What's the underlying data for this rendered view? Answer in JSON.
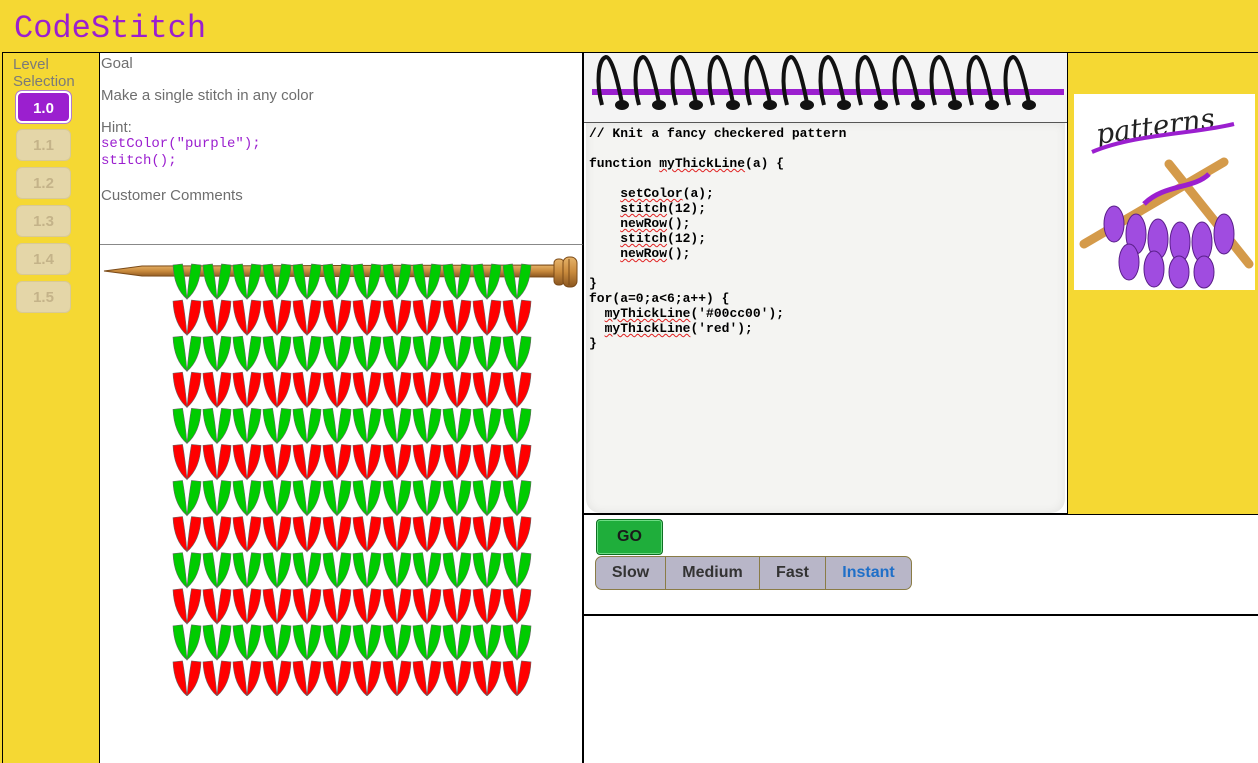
{
  "app": {
    "title": "CodeStitch"
  },
  "levels": {
    "heading": "Level Selection",
    "items": [
      {
        "label": "1.0",
        "state": "active"
      },
      {
        "label": "1.1",
        "state": "locked"
      },
      {
        "label": "1.2",
        "state": "locked"
      },
      {
        "label": "1.3",
        "state": "locked"
      },
      {
        "label": "1.4",
        "state": "locked"
      },
      {
        "label": "1.5",
        "state": "locked"
      }
    ]
  },
  "goal": {
    "heading": "Goal",
    "text": "Make a single stitch in any color",
    "hint_label": "Hint:",
    "hint_code_1": "setColor(\"purple\");",
    "hint_code_2": "stitch();",
    "comments_label": "Customer Comments"
  },
  "knitting": {
    "stitches_per_row": 12,
    "rows": 12,
    "row_colors": [
      "#00cc00",
      "red",
      "#00cc00",
      "red",
      "#00cc00",
      "red",
      "#00cc00",
      "red",
      "#00cc00",
      "red",
      "#00cc00",
      "red"
    ]
  },
  "editor": {
    "lines": [
      "// Knit a fancy checkered pattern",
      "",
      "function myThickLine(a) {",
      "",
      "    setColor(a);",
      "    stitch(12);",
      "    newRow();",
      "    stitch(12);",
      "    newRow();",
      "",
      "}",
      "for(a=0;a<6;a++) {",
      "  myThickLine('#00cc00');",
      "  myThickLine('red');",
      "}"
    ]
  },
  "patterns": {
    "label": "patterns"
  },
  "controls": {
    "go_label": "GO",
    "speeds": [
      "Slow",
      "Medium",
      "Fast",
      "Instant"
    ],
    "selected_speed": "Instant"
  },
  "colors": {
    "accent": "#9b1fcf",
    "background": "#f5d833",
    "go": "#1fae3b"
  }
}
